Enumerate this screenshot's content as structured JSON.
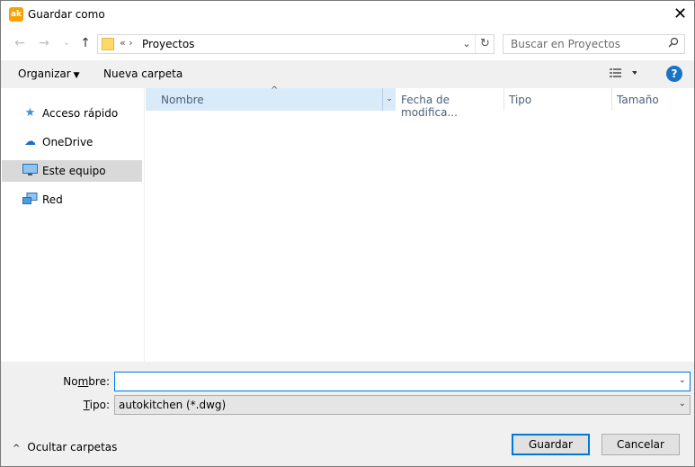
{
  "window": {
    "app_icon_text": "ak",
    "title": "Guardar como",
    "close_glyph": "✕"
  },
  "nav": {
    "back_glyph": "←",
    "forward_glyph": "→",
    "recent_glyph": "⌄",
    "up_glyph": "↑"
  },
  "address": {
    "overflow": "«  ›",
    "current": "Proyectos",
    "dropdown_glyph": "⌄",
    "refresh_glyph": "↻"
  },
  "search": {
    "placeholder": "Buscar en Proyectos",
    "icon": "search-icon"
  },
  "toolbar": {
    "organize_label": "Organizar",
    "new_folder_label": "Nueva carpeta",
    "view_icon": "details-view-icon",
    "help_glyph": "?"
  },
  "navpane": {
    "items": [
      {
        "label": "Acceso rápido",
        "icon": "star-icon",
        "glyph": "★",
        "color": "#3d8fd8",
        "selected": false
      },
      {
        "label": "OneDrive",
        "icon": "cloud-icon",
        "glyph": "☁",
        "color": "#1e6fc4",
        "selected": false
      },
      {
        "label": "Este equipo",
        "icon": "computer-icon",
        "glyph": "▭",
        "color": "#2b88d8",
        "selected": true
      },
      {
        "label": "Red",
        "icon": "network-icon",
        "glyph": "⊞",
        "color": "#2b88d8",
        "selected": false
      }
    ]
  },
  "columns": {
    "name": "Nombre",
    "date": "Fecha de modifica...",
    "type": "Tipo",
    "size": "Tamaño"
  },
  "form": {
    "name_label_pre": "No",
    "name_label_ul": "m",
    "name_label_post": "bre:",
    "name_value": "",
    "type_label_ul": "T",
    "type_label_post": "ipo:",
    "type_value": "autokitchen (*.dwg)"
  },
  "footer": {
    "hide_folders_label": "Ocultar carpetas",
    "save_label": "Guardar",
    "cancel_label": "Cancelar"
  },
  "colors": {
    "accent": "#0078d7",
    "selected_bg": "#d9d9d9",
    "header_active": "#d9ebf9"
  }
}
